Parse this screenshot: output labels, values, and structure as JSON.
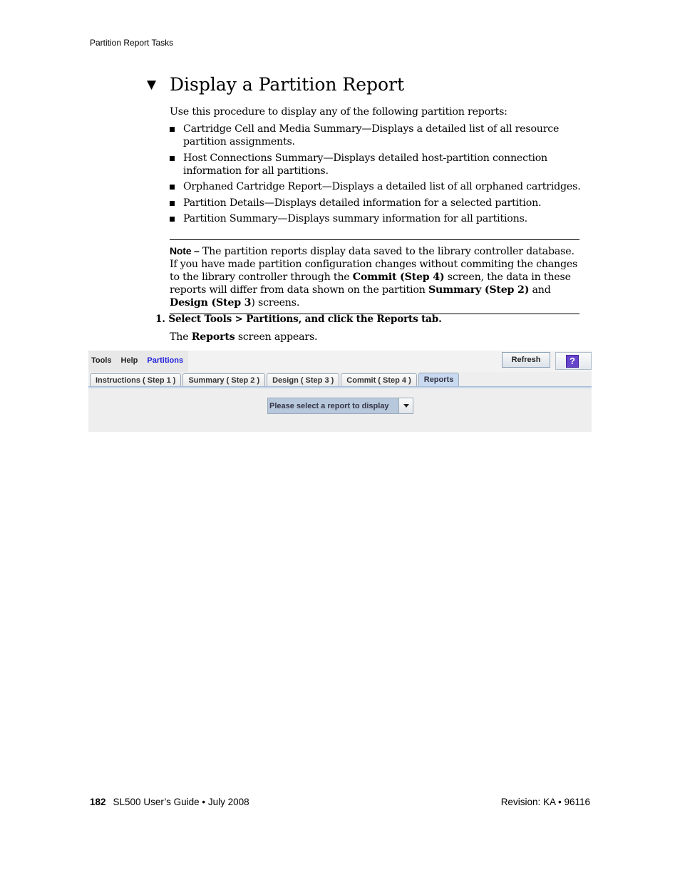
{
  "running_head": "Partition Report Tasks",
  "section": {
    "marker_icon": "down-triangle",
    "title": "Display a Partition Report",
    "intro": "Use this procedure to display any of the following partition reports:",
    "bullets": [
      "Cartridge Cell and Media Summary—Displays a detailed list of all resource partition assignments.",
      "Host Connections Summary—Displays detailed host-partition connection information for all partitions.",
      "Orphaned Cartridge Report—Displays a detailed list of all orphaned cartridges.",
      "Partition Details—Displays detailed information for a selected partition.",
      "Partition Summary—Displays summary information for all partitions."
    ]
  },
  "note": {
    "label": "Note –",
    "text_1": " The partition reports display data saved to the library controller database. If you have made partition configuration changes without commiting the changes to the library controller through the ",
    "bold_1": "Commit (Step 4)",
    "text_2": " screen, the data in these reports will differ from data shown on the partition ",
    "bold_2": "Summary (Step 2)",
    "text_3": " and ",
    "bold_3": "Design (Step 3",
    "text_4": ") screens."
  },
  "steps": [
    {
      "number": "1.",
      "instruction": "Select Tools > Partitions, and click the Reports tab.",
      "result_prefix": "The ",
      "result_bold": "Reports",
      "result_suffix": " screen appears."
    }
  ],
  "ui": {
    "menu": [
      "Tools",
      "Help",
      "Partitions"
    ],
    "active_menu": "Partitions",
    "refresh_label": "Refresh",
    "help_icon": "?",
    "tabs": [
      {
        "label": "Instructions ( Step 1 )",
        "selected": false
      },
      {
        "label": "Summary ( Step 2 )",
        "selected": false
      },
      {
        "label": "Design ( Step 3 )",
        "selected": false
      },
      {
        "label": "Commit ( Step 4 )",
        "selected": false
      },
      {
        "label": "Reports",
        "selected": true
      }
    ],
    "report_select": {
      "value": "Please select a report to display"
    },
    "colors": {
      "active_menu": "#2222dd",
      "selected_tab": "#c9daf0",
      "help_icon_bg": "#6644cc"
    }
  },
  "footer": {
    "page_number": "182",
    "left_text": "SL500 User’s Guide • July 2008",
    "right_text": "Revision: KA • 96116"
  }
}
